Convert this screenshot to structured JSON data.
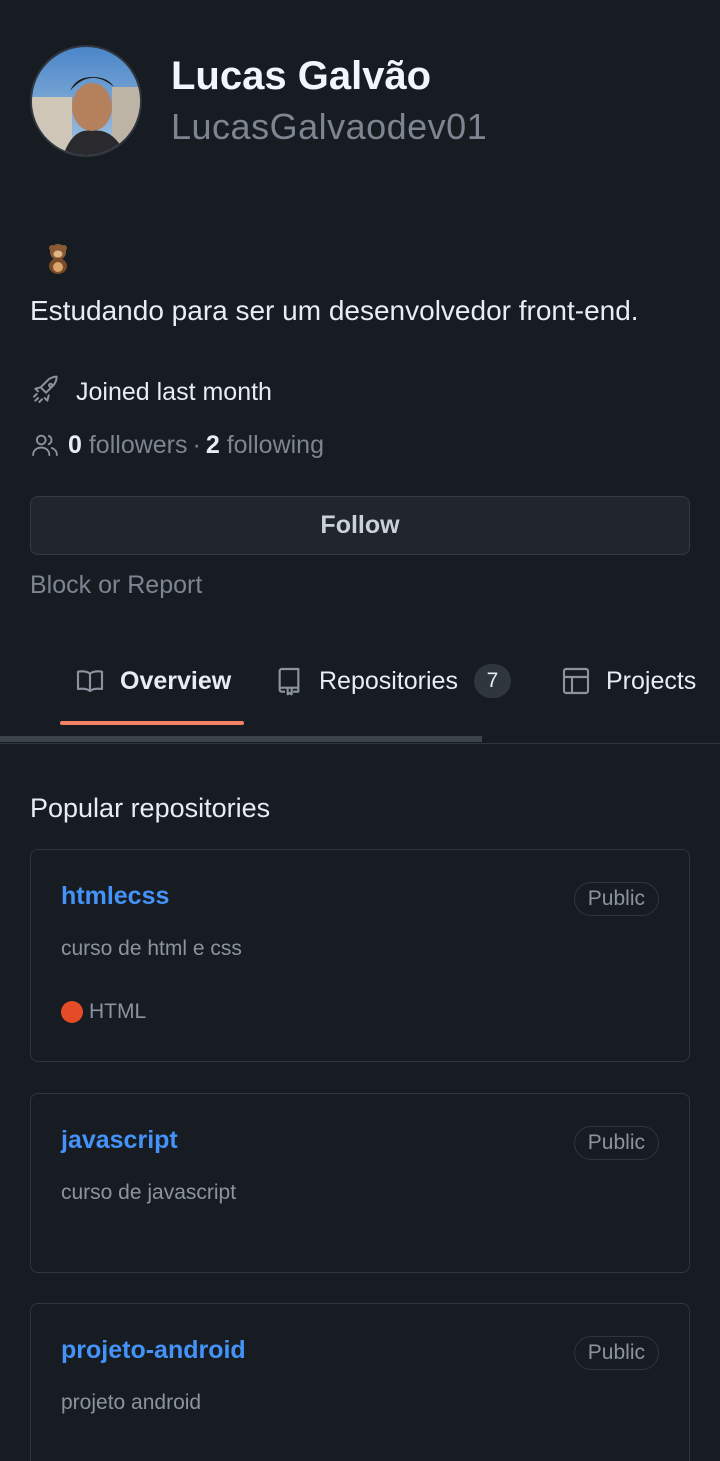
{
  "profile": {
    "name": "Lucas Galvão",
    "login": "LucasGalvaodev01",
    "bio": "Estudando para ser um desenvolvedor front-end.",
    "joined": "Joined last month",
    "followers_count": "0",
    "followers_label": "followers",
    "separator": "·",
    "following_count": "2",
    "following_label": "following"
  },
  "actions": {
    "follow_label": "Follow",
    "block_label": "Block or Report"
  },
  "tabs": [
    {
      "label": "Overview",
      "icon": "book-icon",
      "active": true
    },
    {
      "label": "Repositories",
      "icon": "repo-icon",
      "counter": "7"
    },
    {
      "label": "Projects",
      "icon": "table-icon"
    }
  ],
  "popular": {
    "title": "Popular repositories",
    "repos": [
      {
        "name": "htmlecss",
        "visibility": "Public",
        "description": "curso de html e css",
        "language": "HTML",
        "language_color": "#e34c26"
      },
      {
        "name": "javascript",
        "visibility": "Public",
        "description": "curso de javascript"
      },
      {
        "name": "projeto-android",
        "visibility": "Public",
        "description": "projeto android"
      }
    ]
  },
  "colors": {
    "background": "#171b22",
    "link": "#4493f8",
    "active_tab_underline": "#f78166"
  }
}
